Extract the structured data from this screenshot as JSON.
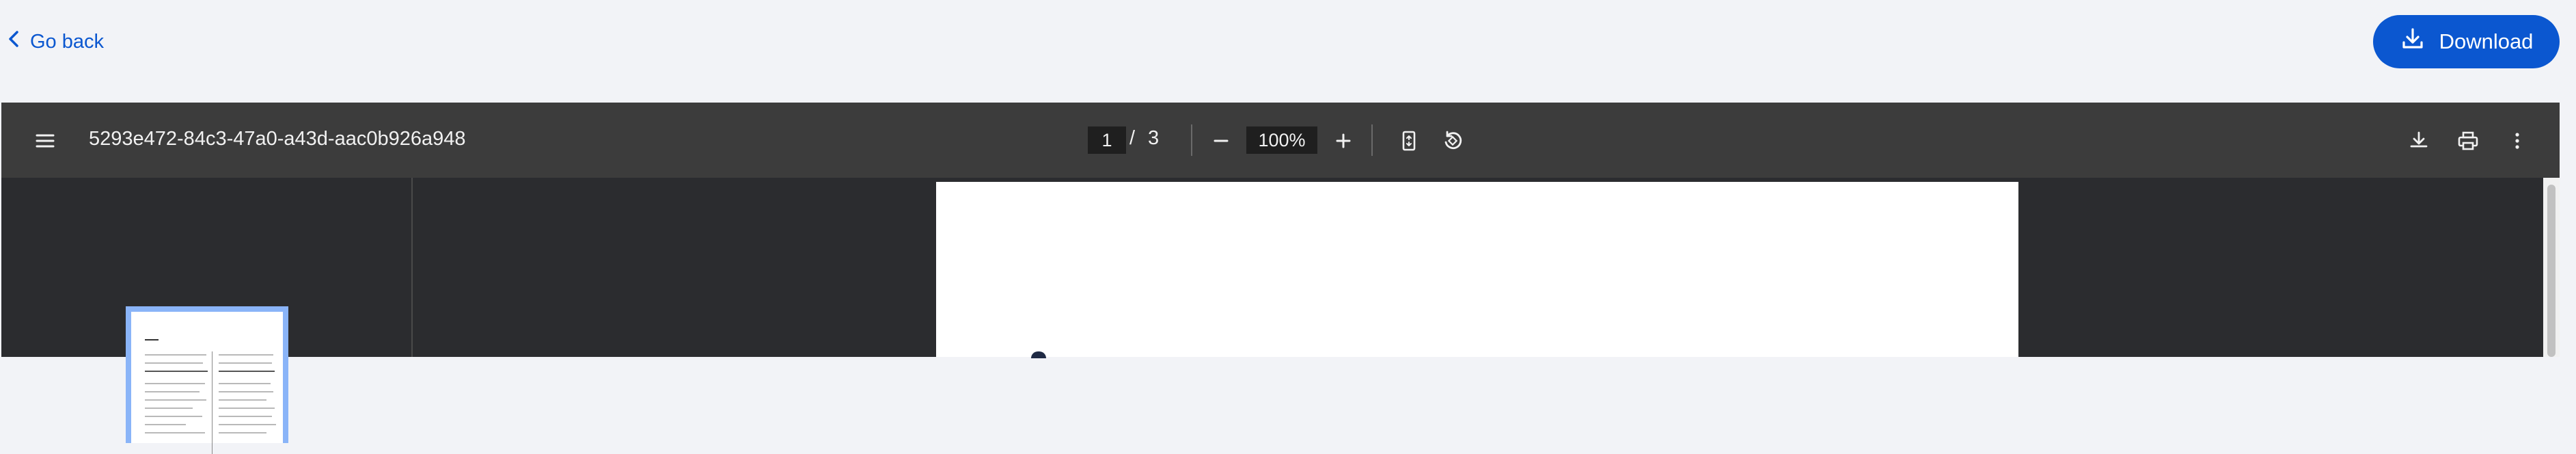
{
  "header": {
    "go_back_label": "Go back",
    "download_label": "Download"
  },
  "viewer": {
    "document_title": "5293e472-84c3-47a0-a43d-aac0b926a948",
    "current_page": "1",
    "page_separator": "/",
    "total_pages": "3",
    "zoom": "100%"
  },
  "colors": {
    "accent": "#0b57d0",
    "toolbar_bg": "#3c3c3c",
    "viewer_bg": "#2b2c2f",
    "thumb_highlight": "#8ab4f8"
  },
  "icons": {
    "menu": "menu-icon",
    "zoom_out": "minus-icon",
    "zoom_in": "plus-icon",
    "fit_page": "fit-page-icon",
    "rotate": "rotate-icon",
    "download": "download-icon",
    "print": "print-icon",
    "more": "more-vertical-icon"
  }
}
